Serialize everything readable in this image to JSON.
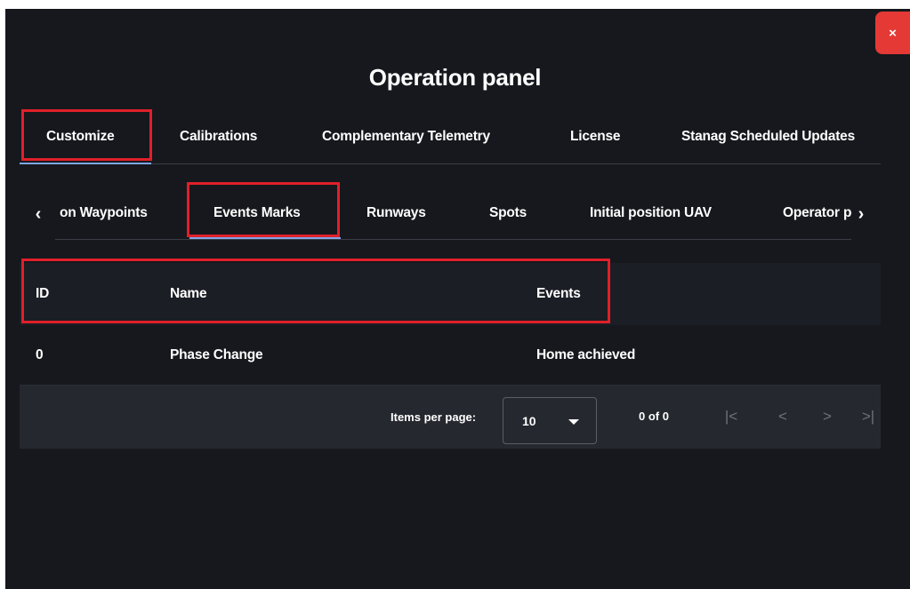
{
  "panel": {
    "title": "Operation panel",
    "close_label": "×"
  },
  "top_tabs": [
    {
      "label": "Customize",
      "active": true
    },
    {
      "label": "Calibrations"
    },
    {
      "label": "Complementary Telemetry"
    },
    {
      "label": "License"
    },
    {
      "label": "Stanag Scheduled Updates"
    }
  ],
  "sub_tabs": {
    "prev_arrow": "‹",
    "next_arrow": "›",
    "items": [
      {
        "label": "on Waypoints"
      },
      {
        "label": "Events Marks",
        "active": true
      },
      {
        "label": "Runways"
      },
      {
        "label": "Spots"
      },
      {
        "label": "Initial position UAV"
      },
      {
        "label": "Operator pc"
      }
    ]
  },
  "table": {
    "columns": [
      "ID",
      "Name",
      "Events"
    ],
    "rows": [
      {
        "id": "0",
        "name": "Phase Change",
        "events": "Home achieved"
      }
    ]
  },
  "paginator": {
    "items_per_page_label": "Items per page:",
    "page_size": "10",
    "range_label": "0 of 0",
    "first_icon": "|<",
    "prev_icon": "<",
    "next_icon": ">",
    "last_icon": ">|"
  },
  "colors": {
    "background": "#16181d",
    "accent_underline": "#7fa6e8",
    "highlight_box": "#e0202a",
    "close_button": "#e53935"
  }
}
